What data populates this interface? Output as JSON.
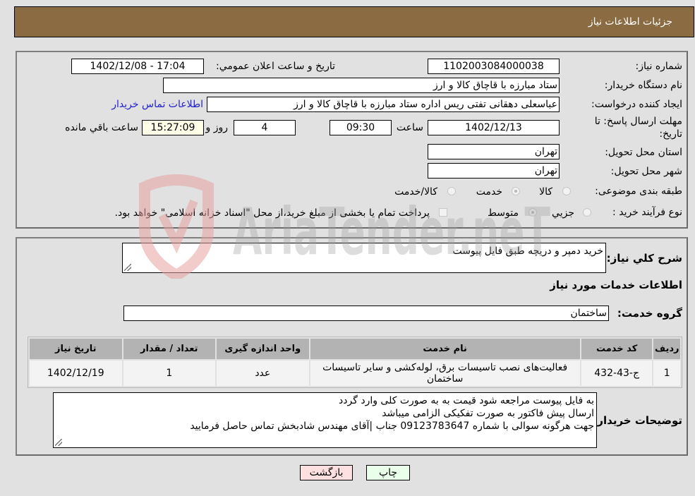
{
  "header": {
    "title": "جزئيات اطلاعات نياز"
  },
  "form": {
    "need_number": {
      "label": "شماره نياز:",
      "value": "1102003084000038"
    },
    "announce_datetime": {
      "label": "تاريخ و ساعت اعلان عمومي:",
      "value": "1402/12/08 - 17:04"
    },
    "buyer_org": {
      "label": "نام دستگاه خريدار:",
      "value": "ستاد مبارزه با قاچاق کالا و ارز"
    },
    "requester": {
      "label": "ايجاد کننده درخواست:",
      "value": "عباسعلی  دهقانی تفتی ریس اداره ستاد مبارزه با قاچاق کالا و ارز",
      "contact_link": "اطلاعات تماس خريدار"
    },
    "deadline": {
      "label_line1": "مهلت ارسال پاسخ: تا",
      "label_line2": "تاريخ:",
      "date": "1402/12/13",
      "time_label": "ساعت",
      "time": "09:30",
      "days": "4",
      "days_label": "روز و",
      "remaining": "15:27:09",
      "remaining_label": "ساعت باقي مانده"
    },
    "province": {
      "label": "استان محل تحويل:",
      "value": "تهران"
    },
    "city": {
      "label": "شهر محل تحويل:",
      "value": "تهران"
    },
    "category": {
      "label": "طبقه بندی موضوعی:",
      "options": [
        "کالا",
        "خدمت",
        "کالا/خدمت"
      ],
      "selected": "خدمت"
    },
    "purchase_type": {
      "label": "نوع فرآيند خريد :",
      "options": [
        "جزيي",
        "متوسط"
      ],
      "selected": "متوسط",
      "treasury_note": "پرداخت تمام يا بخشی از مبلغ خريد،از محل \"اسناد خزانه اسلامی\" خواهد بود."
    }
  },
  "details": {
    "summary_label": "شرح کلي نياز:",
    "summary_value": "خريد دمپر و دريچه طبق فايل پيوست",
    "services_heading": "اطلاعات خدمات مورد نياز",
    "service_group_label": "گروه خدمت:",
    "service_group_value": "ساختمان",
    "table": {
      "headers": [
        "رديف",
        "کد خدمت",
        "نام خدمت",
        "واحد اندازه گيری",
        "تعداد / مقدار",
        "تاريخ نياز"
      ],
      "rows": [
        [
          "1",
          "ج-43-432",
          "فعاليت‌های نصب تاسيسات برق، لوله‌کشی و ساير تاسيسات ساختمان",
          "عدد",
          "1",
          "1402/12/19"
        ]
      ]
    },
    "buyer_notes_label": "توضيحات خريدار:",
    "buyer_notes_lines": [
      "به فايل پيوست مراجعه شود قيمت به به صورت کلی وارد گردد",
      "ارسال پيش فاکتور به صورت تفکيکی الزامی ميباشد",
      "جهت هرگونه سوالی با شماره 09123783647 جناب |آقای مهندس شادبخش تماس حاصل فرماييد"
    ]
  },
  "buttons": {
    "print": "چاپ",
    "back": "بازگشت"
  },
  "watermark": {
    "text": "AriaTender.neT"
  }
}
